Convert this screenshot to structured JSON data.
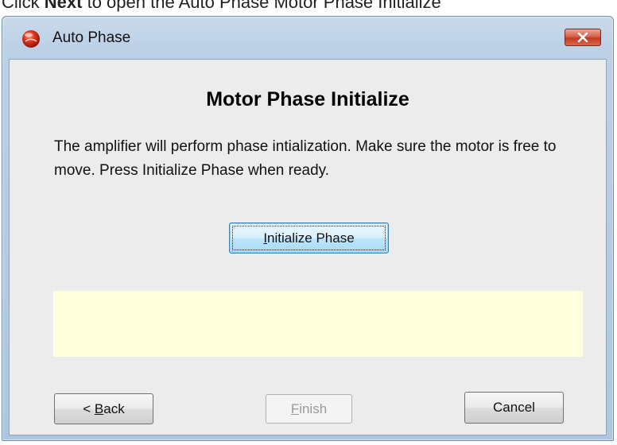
{
  "caption": {
    "prefix": "Click ",
    "bold": "Next",
    "suffix": " to open the Auto Phase Motor Phase Initialize"
  },
  "window": {
    "title": "Auto Phase",
    "icon": "red-app-icon",
    "close_icon": "close-icon"
  },
  "dialog": {
    "heading": "Motor Phase Initialize",
    "message": "The amplifier  will perform phase intialization. Make sure the motor is free to move.  Press Initialize Phase when ready.",
    "status_text": ""
  },
  "buttons": {
    "initialize": {
      "mnemonic": "I",
      "rest": "nitialize Phase"
    },
    "back": {
      "prefix": "< ",
      "mnemonic": "B",
      "rest": "ack"
    },
    "finish": {
      "mnemonic": "F",
      "rest": "inish",
      "enabled": false
    },
    "cancel": {
      "label": "Cancel"
    }
  },
  "colors": {
    "client_bg": "#ececec",
    "status_bg": "#ffffde",
    "close_red": "#c23a21",
    "frame_blue": "#bcd0e6"
  }
}
